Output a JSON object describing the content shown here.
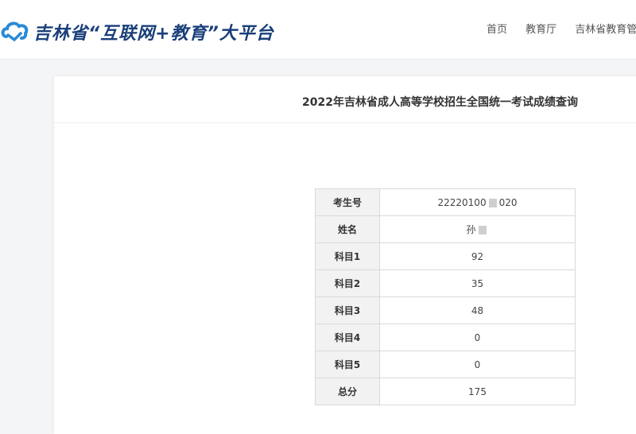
{
  "header": {
    "site_title": "吉林省“互联网+教育”大平台",
    "nav": [
      "首页",
      "教育厅",
      "吉林省教育管理"
    ]
  },
  "main": {
    "page_title": "2022年吉林省成人高等学校招生全国统一考试成绩查询",
    "rows": [
      {
        "label": "考生号",
        "value": "22220100",
        "value_suffix": "020",
        "redacted": true
      },
      {
        "label": "姓名",
        "value": "孙",
        "value_suffix": "",
        "redacted": true
      },
      {
        "label": "科目1",
        "value": "92",
        "value_suffix": "",
        "redacted": false
      },
      {
        "label": "科目2",
        "value": "35",
        "value_suffix": "",
        "redacted": false
      },
      {
        "label": "科目3",
        "value": "48",
        "value_suffix": "",
        "redacted": false
      },
      {
        "label": "科目4",
        "value": "0",
        "value_suffix": "",
        "redacted": false
      },
      {
        "label": "科目5",
        "value": "0",
        "value_suffix": "",
        "redacted": false
      },
      {
        "label": "总分",
        "value": "175",
        "value_suffix": "",
        "redacted": false
      }
    ]
  },
  "colors": {
    "brand": "#1a3f7a",
    "logo": "#2a8ad6"
  },
  "icons": {
    "logo": "cloud-logo-icon"
  }
}
